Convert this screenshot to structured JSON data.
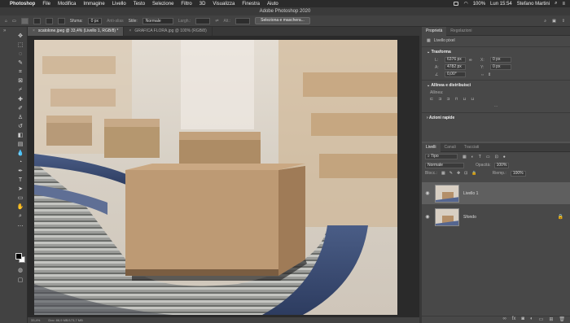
{
  "menubar": {
    "app": "Photoshop",
    "items": [
      "File",
      "Modifica",
      "Immagine",
      "Livello",
      "Testo",
      "Selezione",
      "Filtro",
      "3D",
      "Visualizza",
      "Finestra",
      "Aiuto"
    ],
    "battery": "100%",
    "clock": "Lun 15:54",
    "user": "Stefano Martini"
  },
  "window_title": "Adobe Photoshop 2020",
  "options": {
    "sfuma_label": "Sfuma:",
    "sfuma_value": "0 px",
    "antialias": "Anti-alias",
    "stile_label": "Stile:",
    "stile_value": "Normale",
    "larg_label": "Largh.:",
    "alt_label": "Alt.:",
    "select_mask": "Seleziona e maschera..."
  },
  "tabs": [
    {
      "label": "scatolone.jpeg @ 33,4% (Livello 1, RGB/8) *",
      "active": true
    },
    {
      "label": "GRAFICA FLORA.jpg @ 100% (RGB/8)",
      "active": false
    }
  ],
  "status": {
    "zoom": "33,4%",
    "doc": "Doc: 86,9 MB/173,7 MB"
  },
  "properties": {
    "tabs": [
      "Proprietà",
      "Regolazioni"
    ],
    "layer_type": "Livello pixel",
    "transform_title": "Trasforma",
    "l_label": "L:",
    "l_value": "6376 px",
    "x_label": "X:",
    "x_value": "0 px",
    "a_label": "A:",
    "a_value": "4782 px",
    "y_label": "Y:",
    "y_value": "0 px",
    "angle_value": "0,00°",
    "align_title": "Allinea e distribuisci",
    "align_label": "Allinea:",
    "quick_title": "Azioni rapide"
  },
  "layers": {
    "tabs": [
      "Livelli",
      "Canali",
      "Tracciati"
    ],
    "search": "Tipo",
    "blend": "Normale",
    "opacity_label": "Opacità:",
    "opacity_value": "100%",
    "lock_label": "Blocc.:",
    "fill_label": "Riemp.:",
    "fill_value": "100%",
    "items": [
      {
        "name": "Livello 1",
        "selected": true,
        "locked": false
      },
      {
        "name": "Sfondo",
        "selected": false,
        "locked": true
      }
    ]
  }
}
